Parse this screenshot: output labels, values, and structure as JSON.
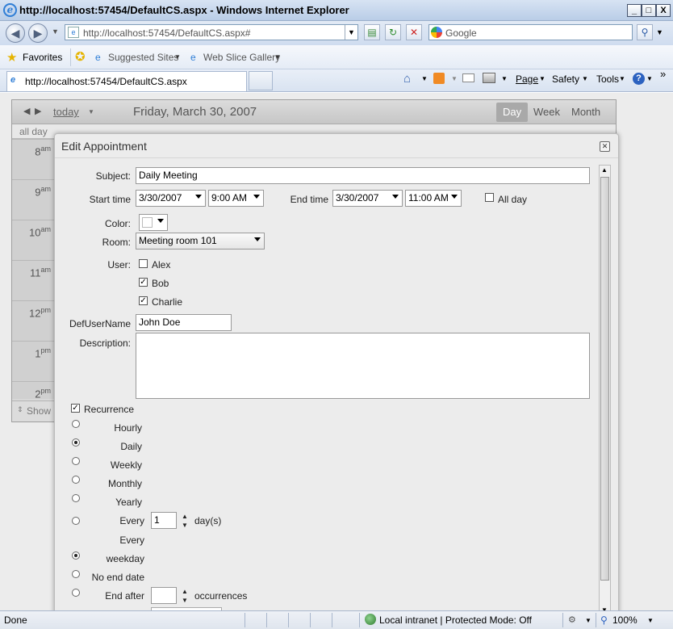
{
  "window": {
    "title": "http://localhost:57454/DefaultCS.aspx - Windows Internet Explorer",
    "minimize": "_",
    "maximize": "□",
    "close": "X"
  },
  "nav": {
    "address": "http://localhost:57454/DefaultCS.aspx#",
    "search_placeholder": "Google"
  },
  "favorites_bar": {
    "favorites": "Favorites",
    "suggested_sites": "Suggested Sites",
    "web_slice_gallery": "Web Slice Gallery"
  },
  "tab": {
    "title": "http://localhost:57454/DefaultCS.aspx"
  },
  "command_bar": {
    "page": "Page",
    "safety": "Safety",
    "tools": "Tools"
  },
  "scheduler": {
    "today": "today",
    "date": "Friday, March 30, 2007",
    "views": [
      "Day",
      "Week",
      "Month"
    ],
    "selected_view": "Day",
    "all_day": "all day",
    "hours": [
      {
        "h": "8",
        "ampm": "am"
      },
      {
        "h": "9",
        "ampm": "am"
      },
      {
        "h": "10",
        "ampm": "am"
      },
      {
        "h": "11",
        "ampm": "am"
      },
      {
        "h": "12",
        "ampm": "pm"
      },
      {
        "h": "1",
        "ampm": "pm"
      },
      {
        "h": "2",
        "ampm": "pm"
      }
    ],
    "show_label": "Show"
  },
  "dialog": {
    "title": "Edit Appointment",
    "subject_label": "Subject:",
    "subject": "Daily Meeting",
    "start_label": "Start time",
    "start_date": "3/30/2007",
    "start_time": "9:00 AM",
    "end_label": "End time",
    "end_date": "3/30/2007",
    "end_time": "11:00 AM",
    "all_day_label": "All day",
    "color_label": "Color:",
    "room_label": "Room:",
    "room": "Meeting room 101",
    "user_label": "User:",
    "users": [
      {
        "name": "Alex",
        "checked": false
      },
      {
        "name": "Bob",
        "checked": true
      },
      {
        "name": "Charlie",
        "checked": true
      }
    ],
    "defuser_label": "DefUserName",
    "defuser": "John Doe",
    "description_label": "Description:",
    "description": "",
    "recurrence_label": "Recurrence",
    "recurrence_checked": true,
    "frequencies": [
      "Hourly",
      "Daily",
      "Weekly",
      "Monthly",
      "Yearly"
    ],
    "selected_frequency": "Daily",
    "every_label": "Every",
    "every_value": "1",
    "days_suffix": "day(s)",
    "every_weekday_line1": "Every",
    "every_weekday_line2": "weekday",
    "no_end_label": "No end date",
    "end_after_label": "End after",
    "occurrences_label": "occurrences"
  },
  "status": {
    "text": "Done",
    "zone": "Local intranet | Protected Mode: Off",
    "zoom": "100%"
  },
  "colors": {
    "titlebar": "#c8d8ee",
    "selected_view": "#a9a9a9",
    "dialog_bg": "#ececec"
  }
}
